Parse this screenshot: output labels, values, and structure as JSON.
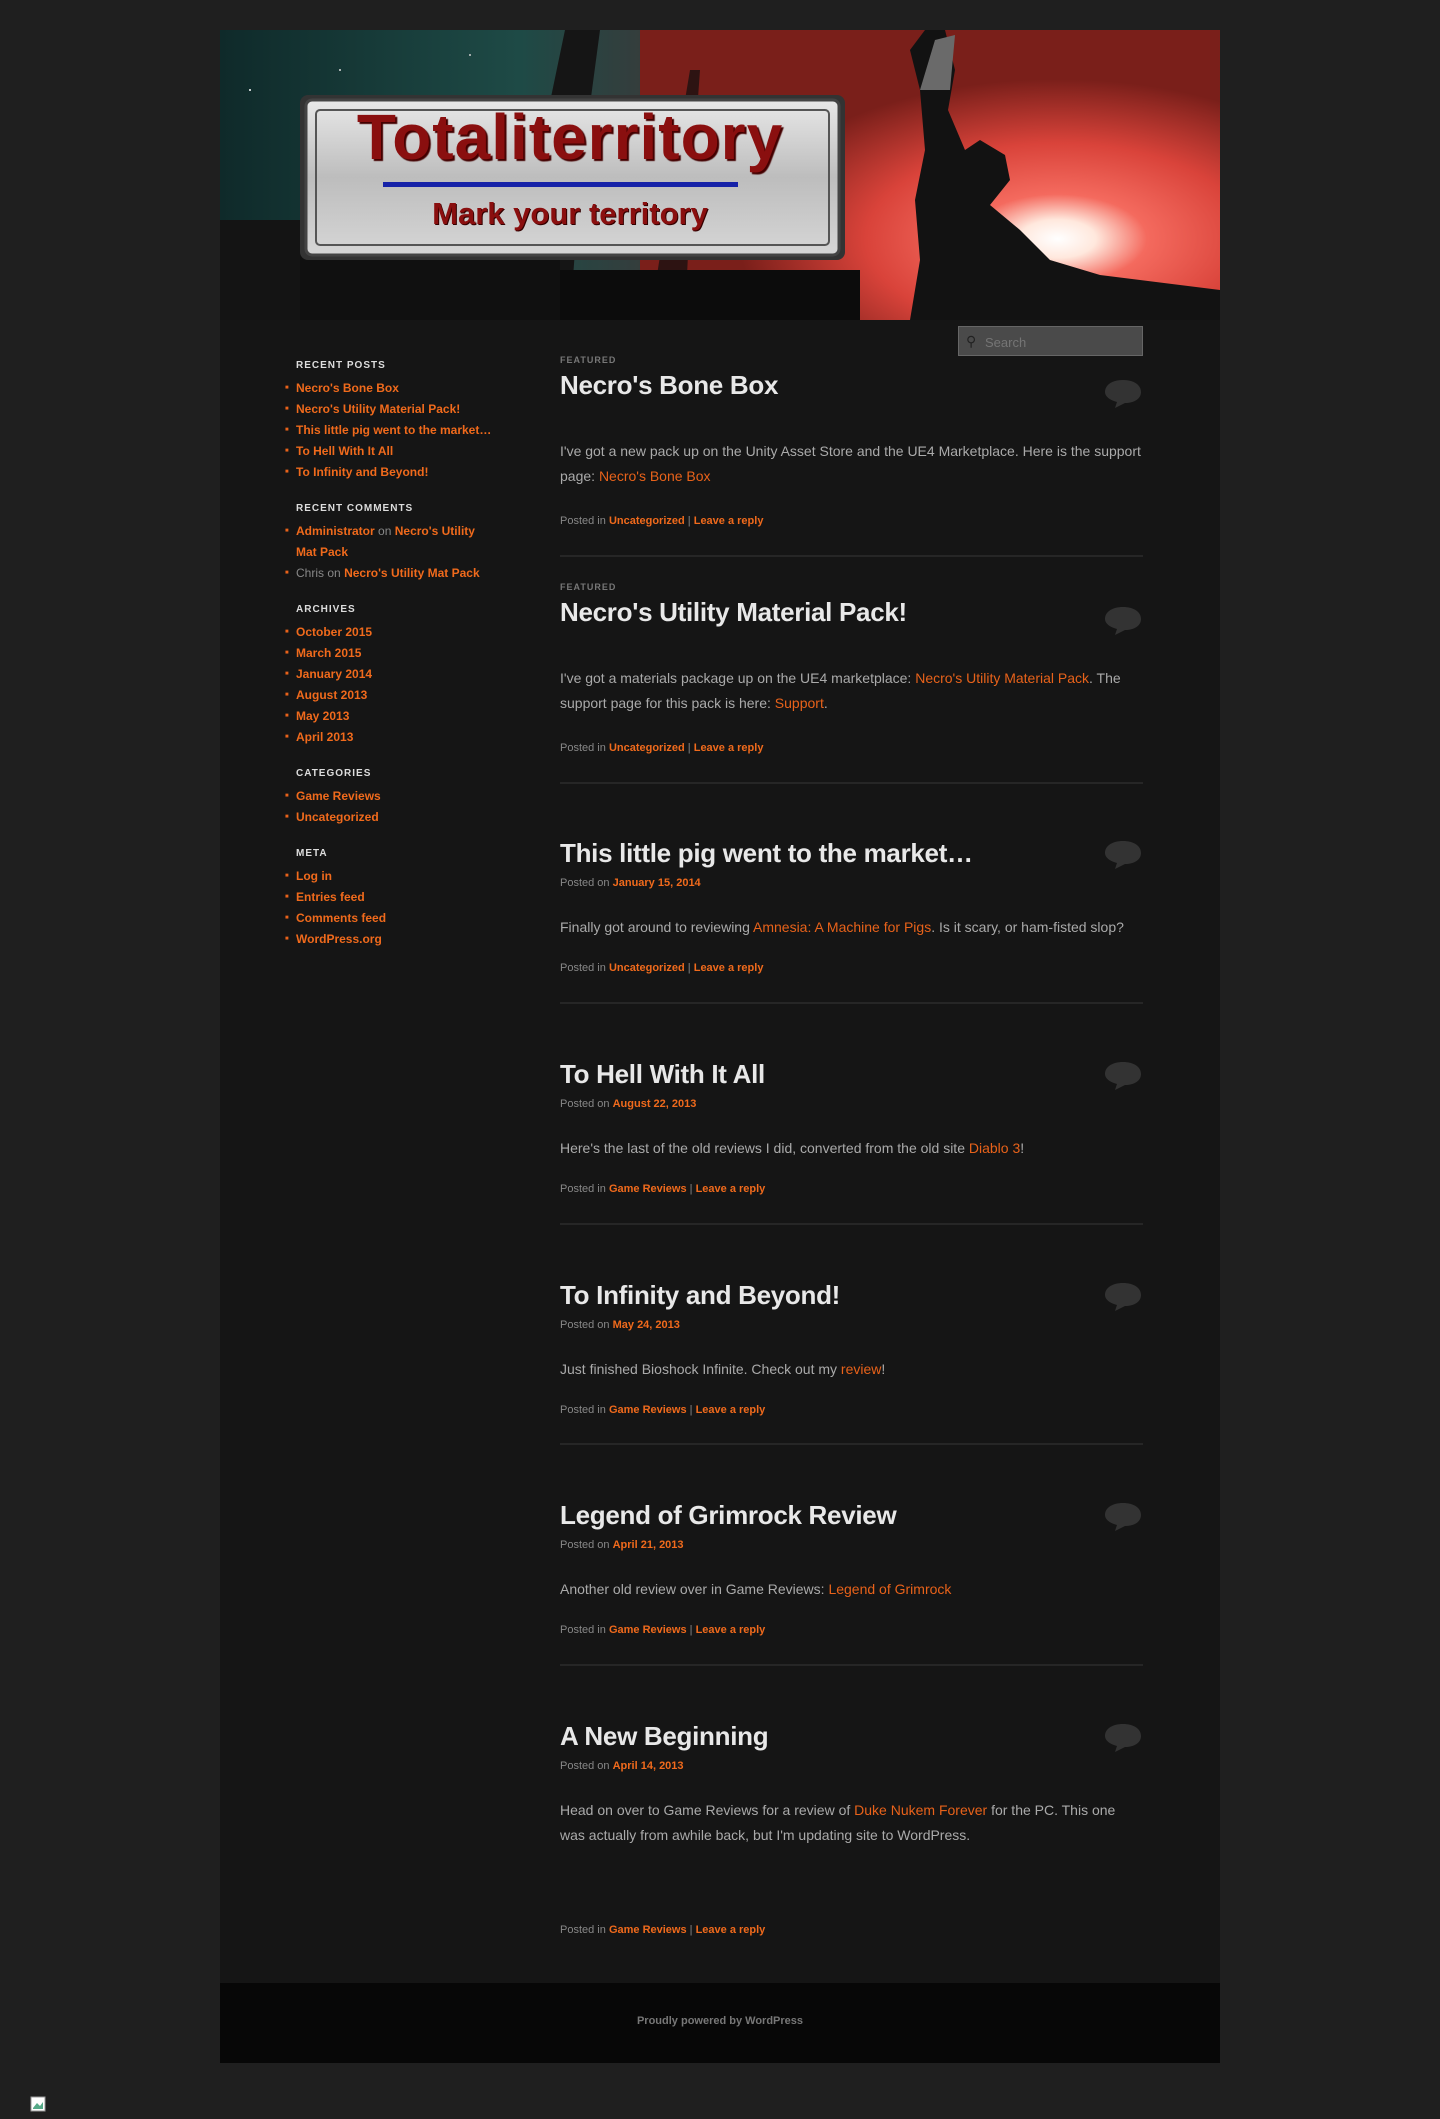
{
  "site": {
    "title": "Totaliterritory",
    "tagline": "Mark your territory"
  },
  "search": {
    "placeholder": "Search"
  },
  "sidebar": {
    "recent_posts": {
      "heading": "RECENT POSTS",
      "items": [
        "Necro's Bone Box",
        "Necro's Utility Material Pack!",
        "This little pig went to the market…",
        "To Hell With It All",
        "To Infinity and Beyond!"
      ]
    },
    "recent_comments": {
      "heading": "RECENT COMMENTS",
      "items": [
        {
          "author": "Administrator",
          "on": "on",
          "post": "Necro's Utility Mat Pack"
        },
        {
          "author": "Chris",
          "on": "on",
          "post": "Necro's Utility Mat Pack"
        }
      ]
    },
    "archives": {
      "heading": "ARCHIVES",
      "items": [
        "October 2015",
        "March 2015",
        "January 2014",
        "August 2013",
        "May 2013",
        "April 2013"
      ]
    },
    "categories": {
      "heading": "CATEGORIES",
      "items": [
        "Game Reviews",
        "Uncategorized"
      ]
    },
    "meta": {
      "heading": "META",
      "items": [
        "Log in",
        "Entries feed",
        "Comments feed",
        "WordPress.org"
      ]
    }
  },
  "labels": {
    "featured": "FEATURED",
    "posted_on": "Posted on",
    "posted_in": "Posted in",
    "leave_reply": "Leave a reply",
    "sep": "|"
  },
  "posts": [
    {
      "title": "Necro's Bone Box",
      "category": "Uncategorized",
      "body_pre": "I've got a new pack up on the Unity Asset Store and the UE4 Marketplace. Here is the support page: ",
      "body_link": "Necro's Bone Box"
    },
    {
      "title": "Necro's Utility Material Pack!",
      "category": "Uncategorized",
      "body_pre": "I've got a materials package up on the UE4 marketplace: ",
      "body_link": "Necro's Utility Material Pack",
      "body_mid": ". The support page for this pack is here: ",
      "body_link2": "Support",
      "body_post": "."
    },
    {
      "title": "This little pig went to the market…",
      "date": "January 15, 2014",
      "category": "Uncategorized",
      "body_pre": "Finally got around to reviewing ",
      "body_link": "Amnesia: A Machine for Pigs",
      "body_post": ". Is it scary, or ham-fisted slop?"
    },
    {
      "title": "To Hell With It All",
      "date": "August 22, 2013",
      "category": "Game Reviews",
      "body_pre": "Here's the last of the old reviews I did, converted from the old site ",
      "body_link": "Diablo 3",
      "body_post": "!"
    },
    {
      "title": "To Infinity and Beyond!",
      "date": "May 24, 2013",
      "category": "Game Reviews",
      "body_pre": "Just finished Bioshock Infinite. Check out my ",
      "body_link": "review",
      "body_post": "!"
    },
    {
      "title": "Legend of Grimrock Review",
      "date": "April 21, 2013",
      "category": "Game Reviews",
      "body_pre": "Another old review over in Game Reviews: ",
      "body_link": "Legend of Grimrock"
    },
    {
      "title": "A New Beginning",
      "date": "April 14, 2013",
      "category": "Game Reviews",
      "body_pre": "Head on over to Game Reviews for a review of ",
      "body_link": "Duke Nukem Forever",
      "body_post": " for the PC. This one was actually from awhile back, but I'm updating site to WordPress."
    }
  ],
  "footer": {
    "credit": "Proudly powered by WordPress"
  },
  "colors": {
    "accent": "#f06a1c",
    "background": "#1f1f1f",
    "page": "#151515"
  }
}
